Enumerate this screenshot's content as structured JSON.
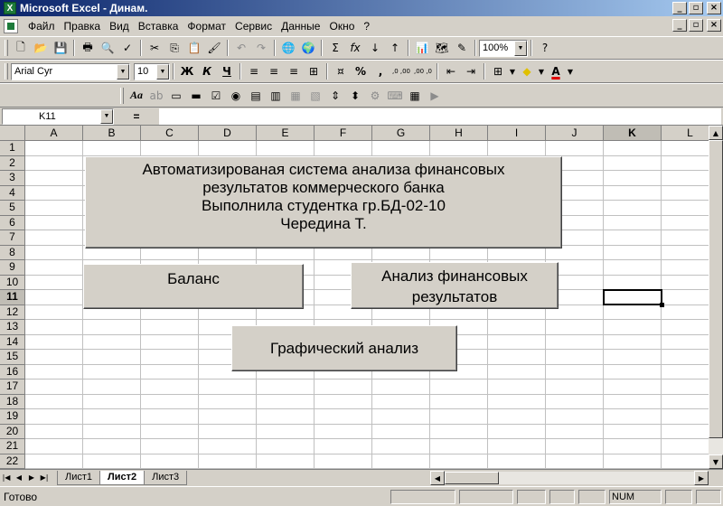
{
  "window": {
    "app_icon": "X",
    "title": "Microsoft Excel - Динам."
  },
  "window_buttons": {
    "minimize": "_",
    "maximize": "▫",
    "close": "×"
  },
  "menu": [
    "Файл",
    "Правка",
    "Вид",
    "Вставка",
    "Формат",
    "Сервис",
    "Данные",
    "Окно",
    "?"
  ],
  "toolbar_standard": {
    "zoom": "100%",
    "sum_label": "Σ",
    "fx_label": "fx"
  },
  "toolbar_format": {
    "font": "Arial Cyr",
    "size": "10",
    "bold": "Ж",
    "italic": "К",
    "underline": "Ч",
    "percent": "%",
    "comma": ",",
    "inc_decimals": ",0 ,00",
    "dec_decimals": ",00 ,0",
    "font_color_letter": "A"
  },
  "toolbar_forms": {
    "label_tool": "Aa"
  },
  "formula_bar": {
    "name_box": "K11",
    "equals": "=",
    "formula": ""
  },
  "columns": [
    "A",
    "B",
    "C",
    "D",
    "E",
    "F",
    "G",
    "H",
    "I",
    "J",
    "K",
    "L"
  ],
  "rows": [
    "1",
    "2",
    "3",
    "4",
    "5",
    "6",
    "7",
    "8",
    "9",
    "10",
    "11",
    "12",
    "13",
    "14",
    "15",
    "16",
    "17",
    "18",
    "19",
    "20",
    "21",
    "22"
  ],
  "selected": {
    "column": "K",
    "row": "11"
  },
  "sheet_buttons": {
    "title_line1": "Автоматизированая система анализа финансовых",
    "title_line2": "результатов коммерческого банка",
    "title_line3": "Выполнила студентка гр.БД-02-10",
    "title_line4": "Чередина Т.",
    "balance": "Баланс",
    "fin_results_line1": "Анализ финансовых",
    "fin_results_line2": "результатов",
    "graphic_analysis": "Графический анализ"
  },
  "tabs": [
    "Лист1",
    "Лист2",
    "Лист3"
  ],
  "active_tab": "Лист2",
  "status": {
    "text": "Готово",
    "num": "NUM"
  },
  "colors": {
    "title_bar_start": "#0a246a",
    "title_bar_end": "#a6caf0",
    "face": "#d4d0c8"
  }
}
